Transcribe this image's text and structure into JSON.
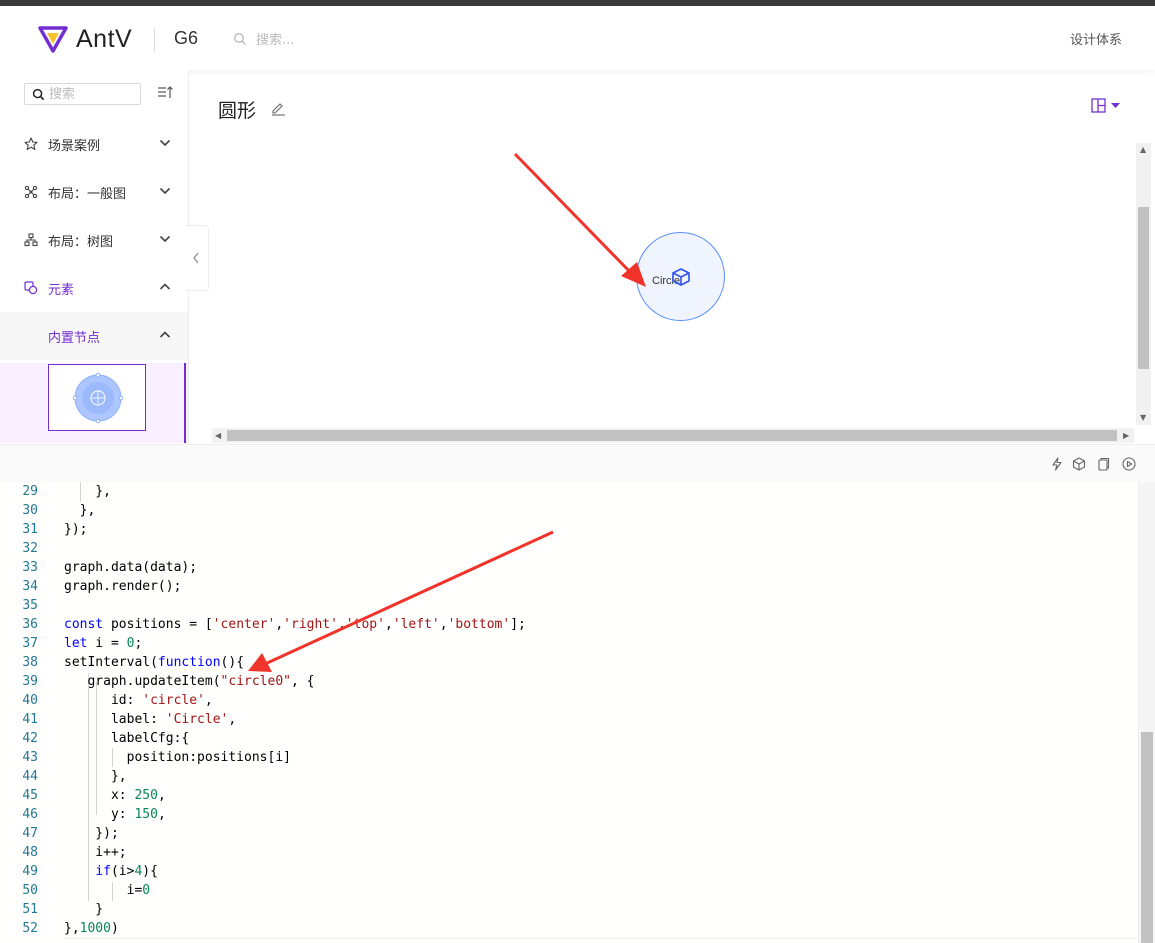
{
  "header": {
    "brand": "AntV",
    "product": "G6",
    "search_placeholder": "搜索...",
    "design_link": "设计体系",
    "brand_color": "#722ed1"
  },
  "sidebar": {
    "search_placeholder": "搜索",
    "items": [
      {
        "label": "场景案例",
        "icon": "star-icon"
      },
      {
        "label": "布局：一般图",
        "icon": "graph-layout-icon"
      },
      {
        "label": "布局：树图",
        "icon": "tree-layout-icon"
      },
      {
        "label": "元素",
        "icon": "element-icon"
      }
    ],
    "submenu_label": "内置节点"
  },
  "main": {
    "title": "圆形"
  },
  "canvas": {
    "node_label": "Circle",
    "node_fill": "#eff4ff",
    "node_stroke": "#5b8ff9"
  },
  "toolbar": {
    "icons": [
      "thunder-icon",
      "codesandbox-icon",
      "copy-icon",
      "play-icon"
    ]
  },
  "editor": {
    "lines": [
      {
        "n": "29",
        "code": "    },"
      },
      {
        "n": "30",
        "code": "  },"
      },
      {
        "n": "31",
        "code": "});"
      },
      {
        "n": "32",
        "code": ""
      },
      {
        "n": "33",
        "code": "graph.data(data);"
      },
      {
        "n": "34",
        "code": "graph.render();"
      },
      {
        "n": "35",
        "code": ""
      },
      {
        "n": "36",
        "code": "const positions = ['center','right','top','left','bottom'];"
      },
      {
        "n": "37",
        "code": "let i = 0;"
      },
      {
        "n": "38",
        "code": "setInterval(function(){"
      },
      {
        "n": "39",
        "code": "   graph.updateItem(\"circle0\", {"
      },
      {
        "n": "40",
        "code": "      id: 'circle',"
      },
      {
        "n": "41",
        "code": "      label: 'Circle',"
      },
      {
        "n": "42",
        "code": "      labelCfg:{"
      },
      {
        "n": "43",
        "code": "        position:positions[i]"
      },
      {
        "n": "44",
        "code": "      },"
      },
      {
        "n": "45",
        "code": "      x: 250,"
      },
      {
        "n": "46",
        "code": "      y: 150,"
      },
      {
        "n": "47",
        "code": "    });"
      },
      {
        "n": "48",
        "code": "    i++;"
      },
      {
        "n": "49",
        "code": "    if(i>4){"
      },
      {
        "n": "50",
        "code": "        i=0"
      },
      {
        "n": "51",
        "code": "    }"
      },
      {
        "n": "52",
        "code": "},1000)"
      }
    ]
  },
  "annotations": {
    "arrow_color": "#f0342b"
  }
}
